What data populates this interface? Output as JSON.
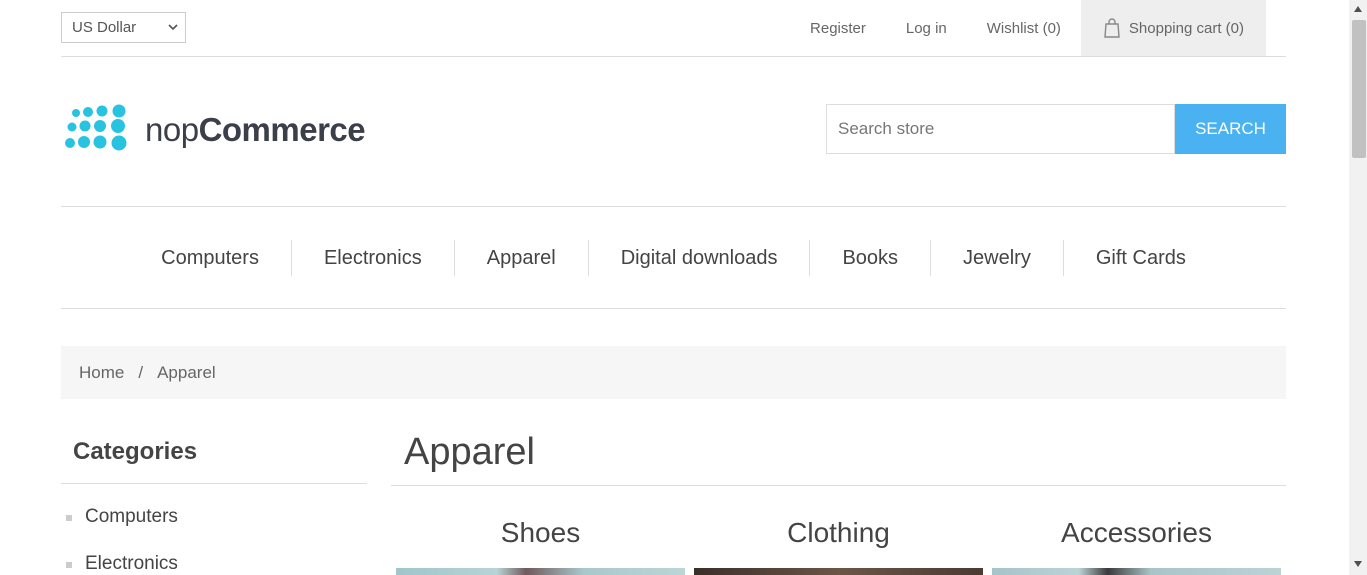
{
  "header": {
    "currency": "US Dollar",
    "register": "Register",
    "login": "Log in",
    "wishlist": "Wishlist (0)",
    "cart": "Shopping cart (0)"
  },
  "logo": {
    "prefix": "nop",
    "suffix": "Commerce"
  },
  "search": {
    "placeholder": "Search store",
    "button": "Search"
  },
  "menu": [
    "Computers",
    "Electronics",
    "Apparel",
    "Digital downloads",
    "Books",
    "Jewelry",
    "Gift Cards"
  ],
  "breadcrumb": {
    "home": "Home",
    "separator": "/",
    "current": "Apparel"
  },
  "sidebar": {
    "title": "Categories",
    "items": [
      "Computers",
      "Electronics"
    ]
  },
  "main": {
    "title": "Apparel",
    "categories": [
      "Shoes",
      "Clothing",
      "Accessories"
    ]
  },
  "colors": {
    "accent": "#4ab2f1",
    "logo_dots": "#29c3e2"
  }
}
